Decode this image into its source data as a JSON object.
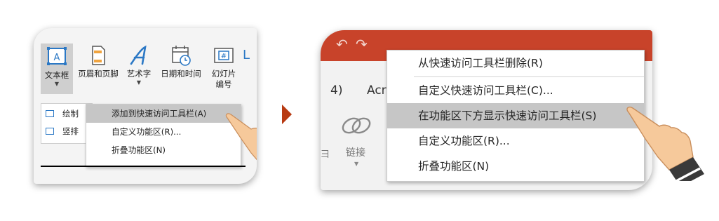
{
  "left_panel": {
    "ribbon": [
      {
        "id": "textbox",
        "lines": [
          "文本框"
        ]
      },
      {
        "id": "header-footer",
        "lines": [
          "页眉和页脚"
        ]
      },
      {
        "id": "wordart",
        "lines": [
          "艺术字"
        ]
      },
      {
        "id": "datetime",
        "lines": [
          "日期和时间"
        ]
      },
      {
        "id": "slide-number",
        "lines": [
          "幻灯片",
          "编号"
        ]
      }
    ],
    "slide_number_icon_text": "#",
    "submenu": [
      {
        "label": "绘制"
      },
      {
        "label": "竖排"
      }
    ],
    "context_menu": [
      {
        "label": "添加到快速访问工具栏(A)",
        "highlighted": true
      },
      {
        "label": "自定义功能区(R)...",
        "highlighted": false
      },
      {
        "label": "折叠功能区(N)",
        "highlighted": false
      }
    ]
  },
  "right_panel": {
    "background_text": {
      "num": "4)",
      "acr": "Acr",
      "link": "链接",
      "side": "彐"
    },
    "context_menu": [
      {
        "label": "从快速访问工具栏删除(R)",
        "highlighted": false
      },
      {
        "label": "自定义快速访问工具栏(C)...",
        "highlighted": false
      },
      {
        "label": "在功能区下方显示快速访问工具栏(S)",
        "highlighted": true
      },
      {
        "label": "自定义功能区(R)...",
        "highlighted": false
      },
      {
        "label": "折叠功能区(N)",
        "highlighted": false
      }
    ]
  },
  "colors": {
    "accent": "#c8432a",
    "arrow": "#b83a12",
    "icon_blue": "#2b78c5",
    "highlight": "#c6c6c6"
  },
  "icons": [
    "textbox-icon",
    "header-footer-icon",
    "wordart-icon",
    "calendar-clock-icon",
    "slide-number-icon",
    "pointing-hand-icon",
    "link-icon",
    "undo-icon",
    "redo-icon"
  ]
}
